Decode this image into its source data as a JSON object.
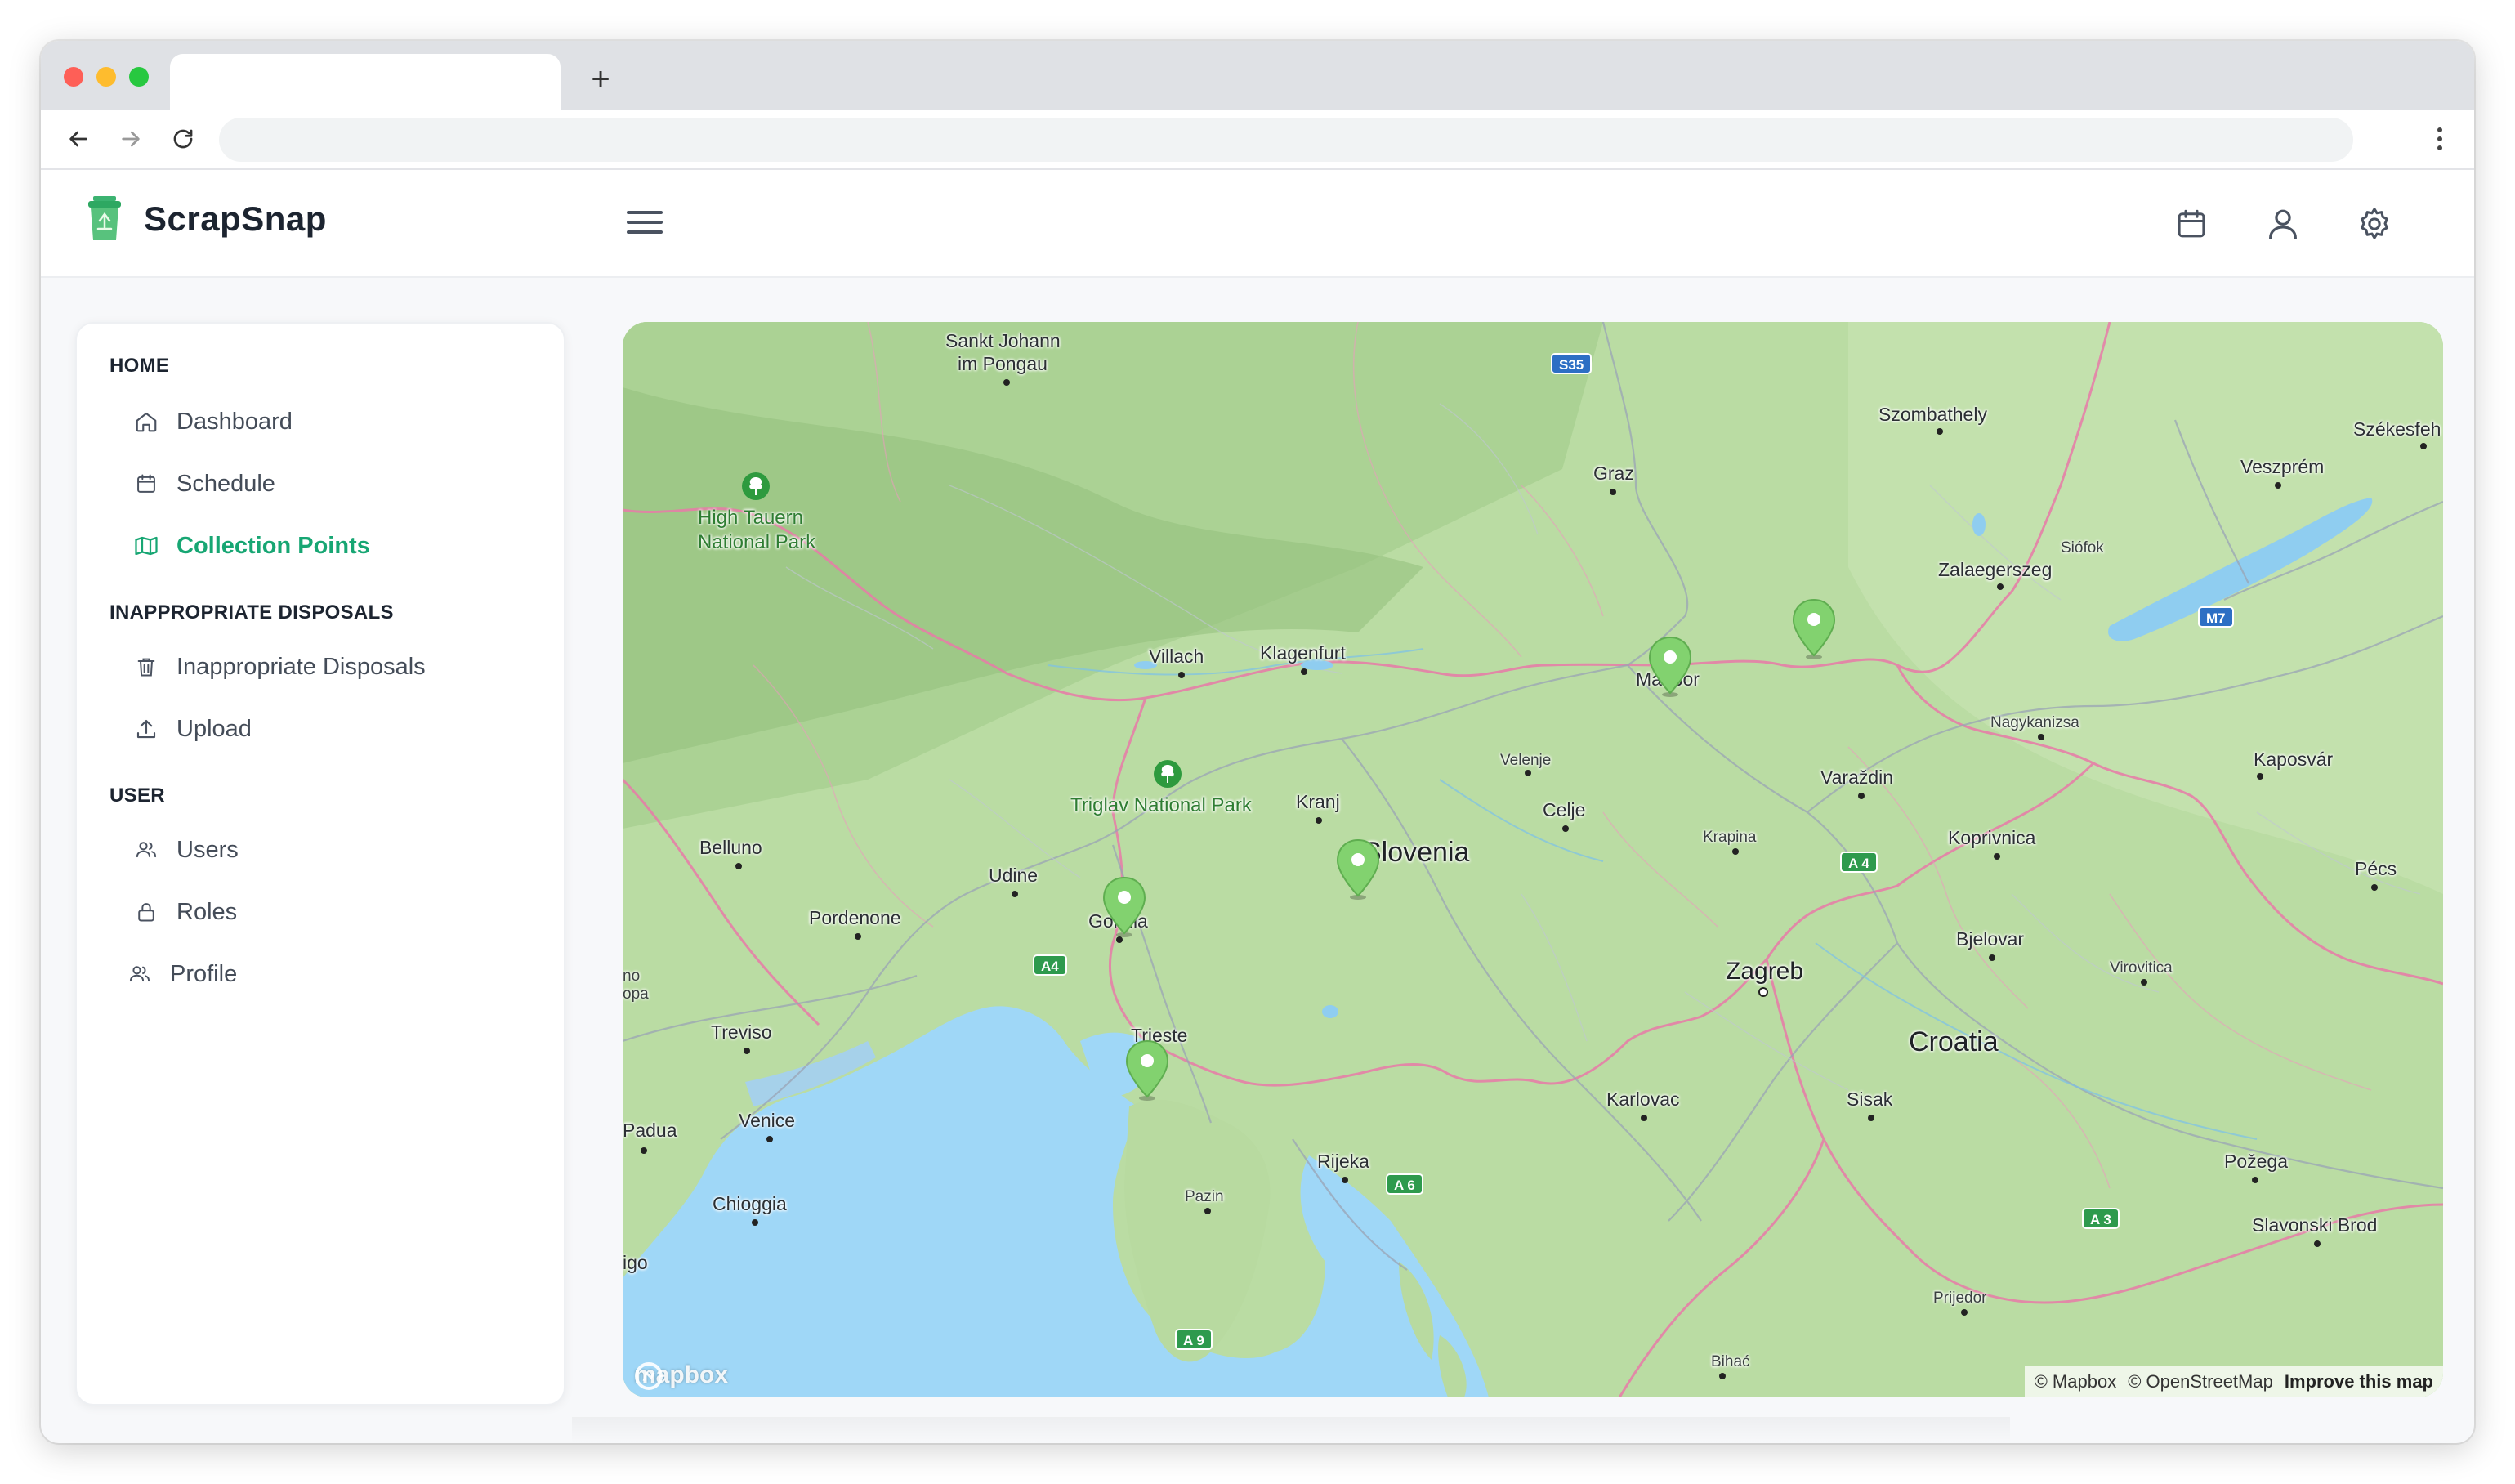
{
  "browser": {
    "url": "",
    "new_tab_label": "+"
  },
  "app": {
    "brand": "ScrapSnap"
  },
  "sidebar": {
    "sections": [
      {
        "title": "HOME"
      },
      {
        "title": "INAPPROPRIATE DISPOSALS"
      },
      {
        "title": "USER"
      }
    ],
    "items": [
      {
        "label": "Dashboard",
        "icon": "home-icon"
      },
      {
        "label": "Schedule",
        "icon": "calendar-icon"
      },
      {
        "label": "Collection Points",
        "icon": "map-icon",
        "active": true
      },
      {
        "label": "Inappropriate Disposals",
        "icon": "trash-icon"
      },
      {
        "label": "Upload",
        "icon": "upload-icon"
      },
      {
        "label": "Users",
        "icon": "users-icon"
      },
      {
        "label": "Roles",
        "icon": "lock-icon"
      },
      {
        "label": "Profile",
        "icon": "users-icon"
      }
    ]
  },
  "map": {
    "countries": {
      "slovenia": "Slovenia",
      "croatia": "Croatia"
    },
    "cities": {
      "sankt_johann": "Sankt Johann",
      "sankt_johann_2": "im Pongau",
      "graz": "Graz",
      "szombathely": "Szombathely",
      "szekesfeh": "Székesfeh",
      "veszprem": "Veszprém",
      "siofok": "Siófok",
      "zalaegerszeg": "Zalaegerszeg",
      "villach": "Villach",
      "klagenfurt": "Klagenfurt",
      "maribor": "Maribor",
      "nagykanizsa": "Nagykanizsa",
      "kaposvar": "Kaposvár",
      "velenje": "Velenje",
      "celje": "Celje",
      "kranj": "Kranj",
      "varazdin": "Varaždin",
      "belluno": "Belluno",
      "udine": "Udine",
      "gorizia": "Gorizia",
      "krapina": "Krapina",
      "koprivnica": "Koprivnica",
      "pecs": "Pécs",
      "pordenone": "Pordenone",
      "zagreb": "Zagreb",
      "bjelovar": "Bjelovar",
      "virovitica": "Virovitica",
      "treviso": "Treviso",
      "trieste": "Trieste",
      "venice": "Venice",
      "padua": "Padua",
      "karlovac": "Karlovac",
      "sisak": "Sisak",
      "chioggia": "Chioggia",
      "rijeka": "Rijeka",
      "pazin": "Pazin",
      "pozega": "Požega",
      "slavonski_brod": "Slavonski Brod",
      "prijedor": "Prijedor",
      "bihac": "Bihać",
      "igo": "igo",
      "no": "no",
      "opa": "opa"
    },
    "parks": {
      "high_tauern_1": "High Tauern",
      "high_tauern_2": "National Park",
      "triglav": "Triglav National Park"
    },
    "roads": {
      "s35": "S35",
      "m7": "M7",
      "a4_hr": "A 4",
      "a4_it": "A4",
      "a6": "A 6",
      "a3": "A 3",
      "a9": "A 9"
    },
    "attribution": {
      "mapbox": "© Mapbox",
      "osm": "© OpenStreetMap",
      "improve": "Improve this map"
    },
    "logo_text": "mapbox"
  },
  "colors": {
    "accent": "#17a673",
    "pin": "#7ccf6a",
    "water": "#9fd7f7",
    "land": "#b9dca1",
    "border": "#e06a9c"
  }
}
